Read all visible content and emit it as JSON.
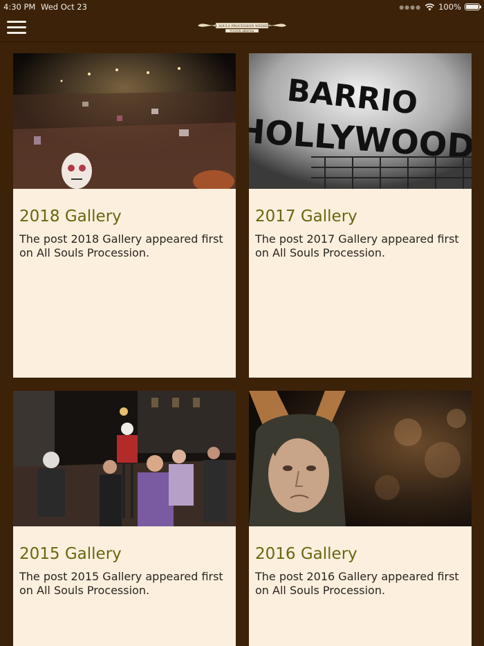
{
  "status": {
    "time": "4:30 PM",
    "date": "Wed Oct 23",
    "battery": "100%"
  },
  "header": {
    "logo_text": "ALL SOULS PROCESSION WEEKEND",
    "logo_subtext": "TUCSON, ARIZONA"
  },
  "posts": [
    {
      "title": "2018 Gallery",
      "excerpt": "The post 2018 Gallery appeared first on All Souls Procession."
    },
    {
      "title": "2017 Gallery",
      "excerpt": "The post 2017 Gallery appeared first on All Souls Procession.",
      "sign_line1": "BARRIO",
      "sign_line2": "HOLLYWOOD"
    },
    {
      "title": "2015 Gallery",
      "excerpt": "The post 2015 Gallery appeared first on All Souls Procession."
    },
    {
      "title": "2016 Gallery",
      "excerpt": "The post 2016 Gallery appeared first on All Souls Procession."
    }
  ],
  "colors": {
    "background": "#3b2209",
    "card": "#fcefdd",
    "title": "#6b6510",
    "text": "#2a2420"
  }
}
